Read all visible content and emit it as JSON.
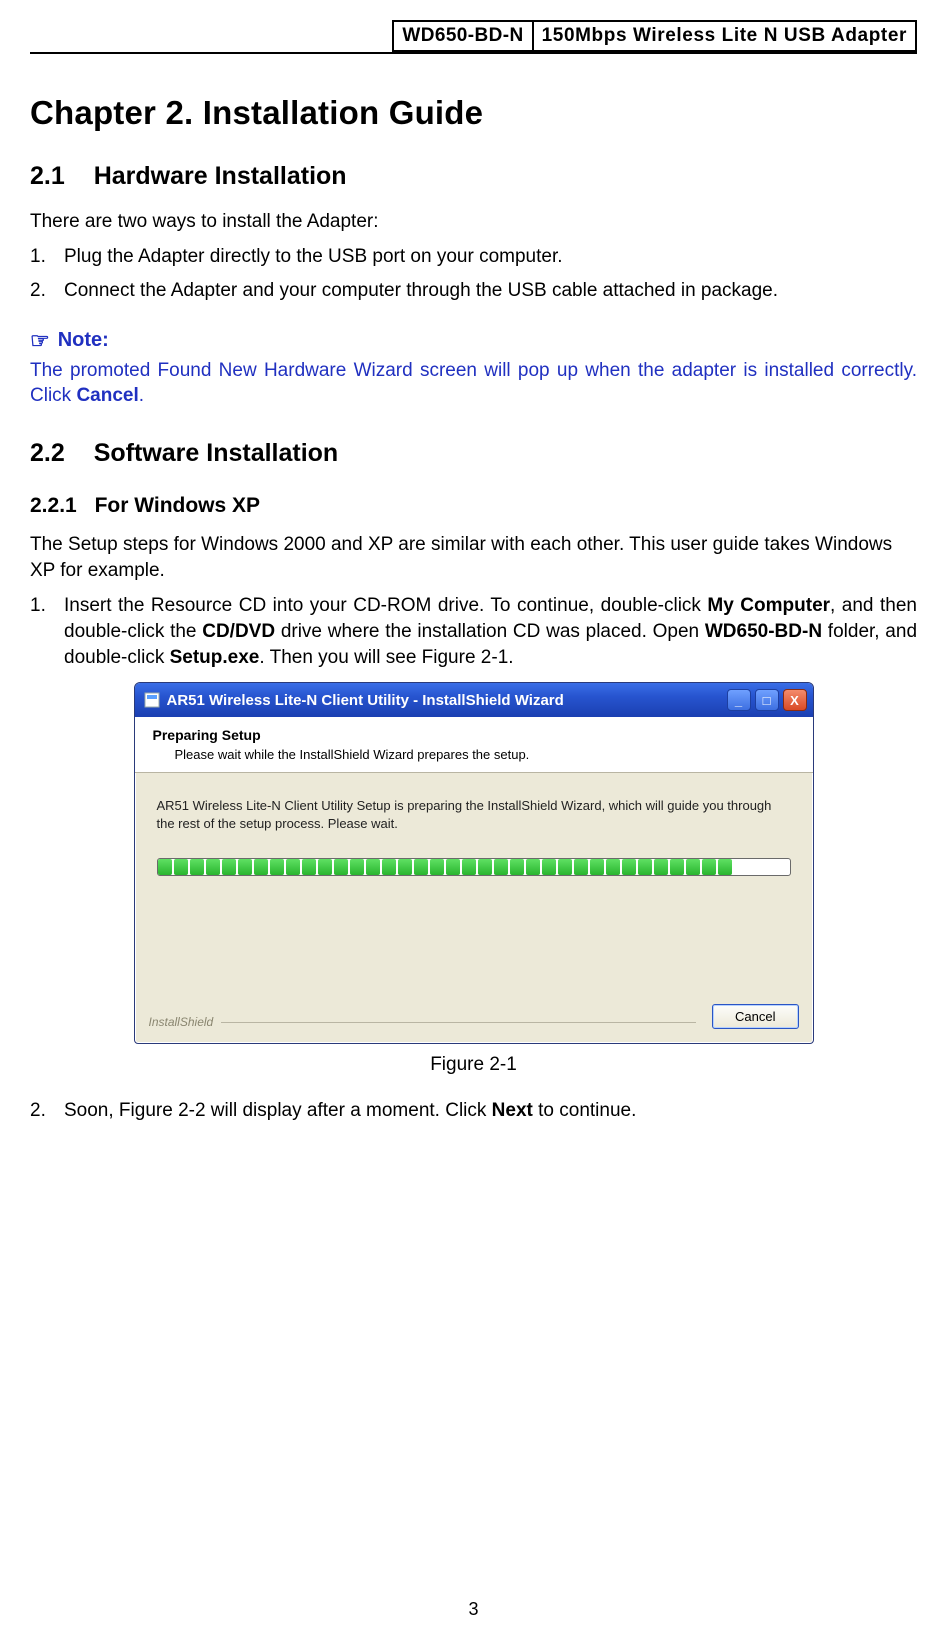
{
  "header": {
    "model": "WD650-BD-N",
    "product": "150Mbps Wireless Lite N USB Adapter"
  },
  "chapter_title": "Chapter 2. Installation Guide",
  "s21": {
    "num": "2.1",
    "title": "Hardware Installation",
    "intro": "There are two ways to install the Adapter:",
    "items": [
      {
        "n": "1.",
        "t": "Plug the Adapter directly to the USB port on your computer."
      },
      {
        "n": "2.",
        "t": "Connect the Adapter and your computer through the USB cable attached in package."
      }
    ]
  },
  "note": {
    "icon": "☞",
    "label": "Note:",
    "body_pre": "The promoted Found New Hardware Wizard screen will pop up when the adapter is installed correctly. Click ",
    "body_bold": "Cancel",
    "body_post": "."
  },
  "s22": {
    "num": "2.2",
    "title": "Software Installation"
  },
  "s221": {
    "num": "2.2.1",
    "title": "For Windows XP",
    "intro": "The Setup steps for Windows 2000 and XP are similar with each other. This user guide takes Windows XP for example.",
    "step1": {
      "n": "1.",
      "run": [
        {
          "t": "Insert the Resource CD into your CD-ROM drive. To continue, double-click "
        },
        {
          "t": "My Computer",
          "b": true
        },
        {
          "t": ", and then double-click the "
        },
        {
          "t": "CD/DVD",
          "b": true
        },
        {
          "t": " drive where the installation CD was placed. Open "
        },
        {
          "t": "WD650-BD-N",
          "b": true
        },
        {
          "t": " folder, and double-click "
        },
        {
          "t": "Setup.exe",
          "b": true
        },
        {
          "t": ". Then you will see Figure 2-1."
        }
      ]
    },
    "step2": {
      "n": "2.",
      "run": [
        {
          "t": "Soon, Figure 2-2 will display after a moment. Click "
        },
        {
          "t": "Next",
          "b": true
        },
        {
          "t": " to continue."
        }
      ]
    }
  },
  "dialog": {
    "title": "AR51 Wireless Lite-N Client Utility - InstallShield Wizard",
    "controls": {
      "min": "_",
      "max": "□",
      "close": "X"
    },
    "preparing": "Preparing Setup",
    "preparing_sub": "Please wait while the InstallShield Wizard prepares the setup.",
    "body": "AR51 Wireless Lite-N Client Utility Setup is preparing the InstallShield Wizard, which will guide you through the rest of the setup process. Please wait.",
    "brand": "InstallShield",
    "cancel": "Cancel",
    "progress_segments": 36
  },
  "figure_caption": "Figure 2-1",
  "page_number": "3"
}
